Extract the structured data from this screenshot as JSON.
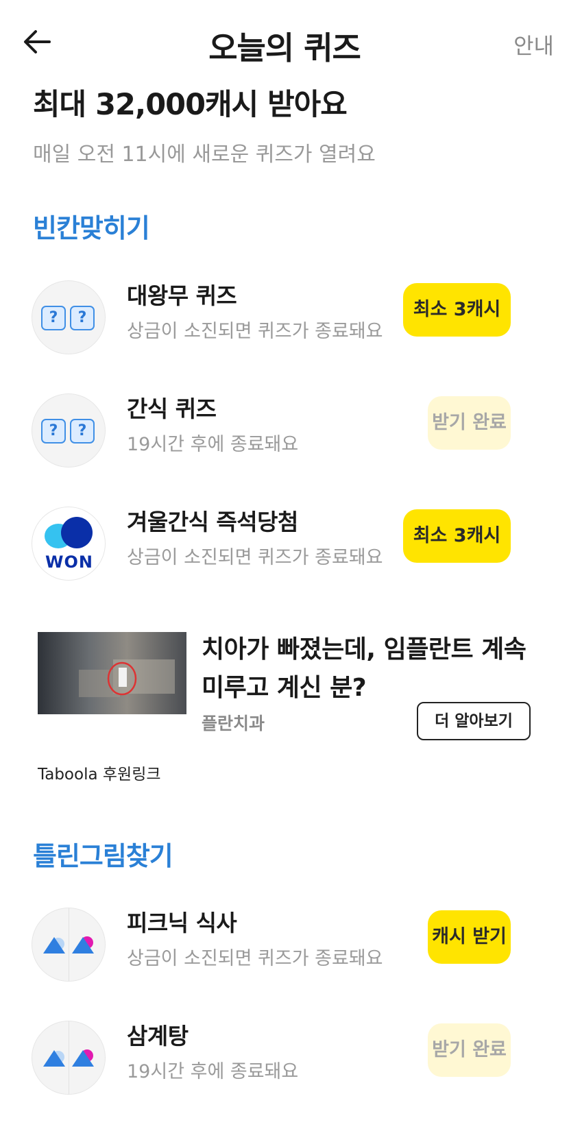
{
  "header": {
    "title": "오늘의 퀴즈",
    "guide_label": "안내",
    "back_icon": "arrow-left-icon"
  },
  "hero": {
    "title": "최대 32,000캐시 받아요",
    "subtitle": "매일 오전 11시에 새로운 퀴즈가 열려요"
  },
  "sections": [
    {
      "title": "빈칸맞히기",
      "items": [
        {
          "title": "대왕무 퀴즈",
          "subtitle": "상금이 소진되면 퀴즈가 종료돼요",
          "button": "최소 3캐시",
          "state": "active",
          "icon": "question-marks-icon"
        },
        {
          "title": "간식 퀴즈",
          "subtitle": "19시간 후에 종료돼요",
          "button": "받기 완료",
          "state": "done",
          "icon": "question-marks-icon"
        },
        {
          "title": "겨울간식 즉석당첨",
          "subtitle": "상금이 소진되면 퀴즈가 종료돼요",
          "button": "최소 3캐시",
          "state": "active",
          "icon": "won-logo"
        }
      ]
    },
    {
      "title": "틀린그림찾기",
      "items": [
        {
          "title": "피크닉 식사",
          "subtitle": "상금이 소진되면 퀴즈가 종료돼요",
          "button": "캐시 받기",
          "state": "active",
          "icon": "spot-difference-icon"
        },
        {
          "title": "삼계탕",
          "subtitle": "19시간 후에 종료돼요",
          "button": "받기 완료",
          "state": "done",
          "icon": "spot-difference-icon"
        }
      ]
    }
  ],
  "qmark": "?",
  "won_logo_text": "WON",
  "ad": {
    "title": "치아가 빠졌는데, 임플란트 계속 미루고 계신 분?",
    "source": "플란치과",
    "cta": "더 알아보기",
    "sponsor": "Taboola 후원링크"
  },
  "colors": {
    "accent_blue": "#2a80d6",
    "button_yellow": "#ffe400",
    "button_done": "#fff8d3"
  }
}
